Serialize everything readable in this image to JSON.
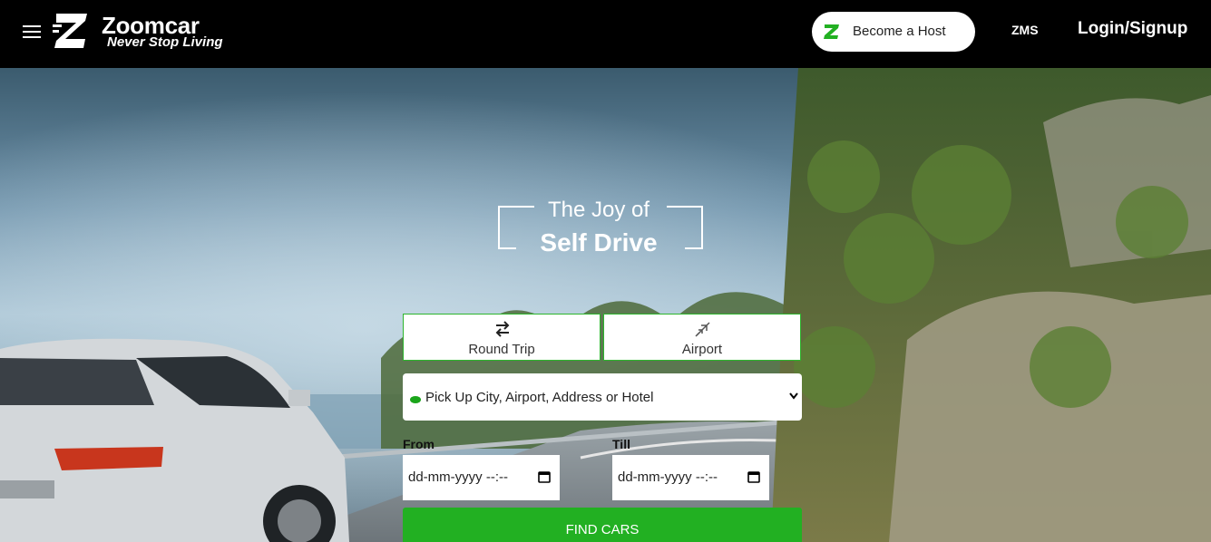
{
  "nav": {
    "brand": "Zoomcar",
    "tagline": "Never Stop Living",
    "host_button": "Become a Host",
    "zms": "ZMS",
    "login": "Login/Signup"
  },
  "hero": {
    "headline_line1": "The Joy of",
    "headline_line2": "Self Drive"
  },
  "search": {
    "tabs": [
      {
        "label": "Round Trip",
        "icon": "swap-arrows-icon"
      },
      {
        "label": "Airport",
        "icon": "airplane-icon"
      }
    ],
    "pickup_placeholder": "Pick Up City, Airport, Address or Hotel",
    "from_label": "From",
    "till_label": "Till",
    "from_value": "dd-mm-yyyy --:--",
    "till_value": "dd-mm-yyyy --:--",
    "find_button": "FIND CARS"
  },
  "colors": {
    "accent": "#22b022",
    "nav_bg": "#000000"
  }
}
